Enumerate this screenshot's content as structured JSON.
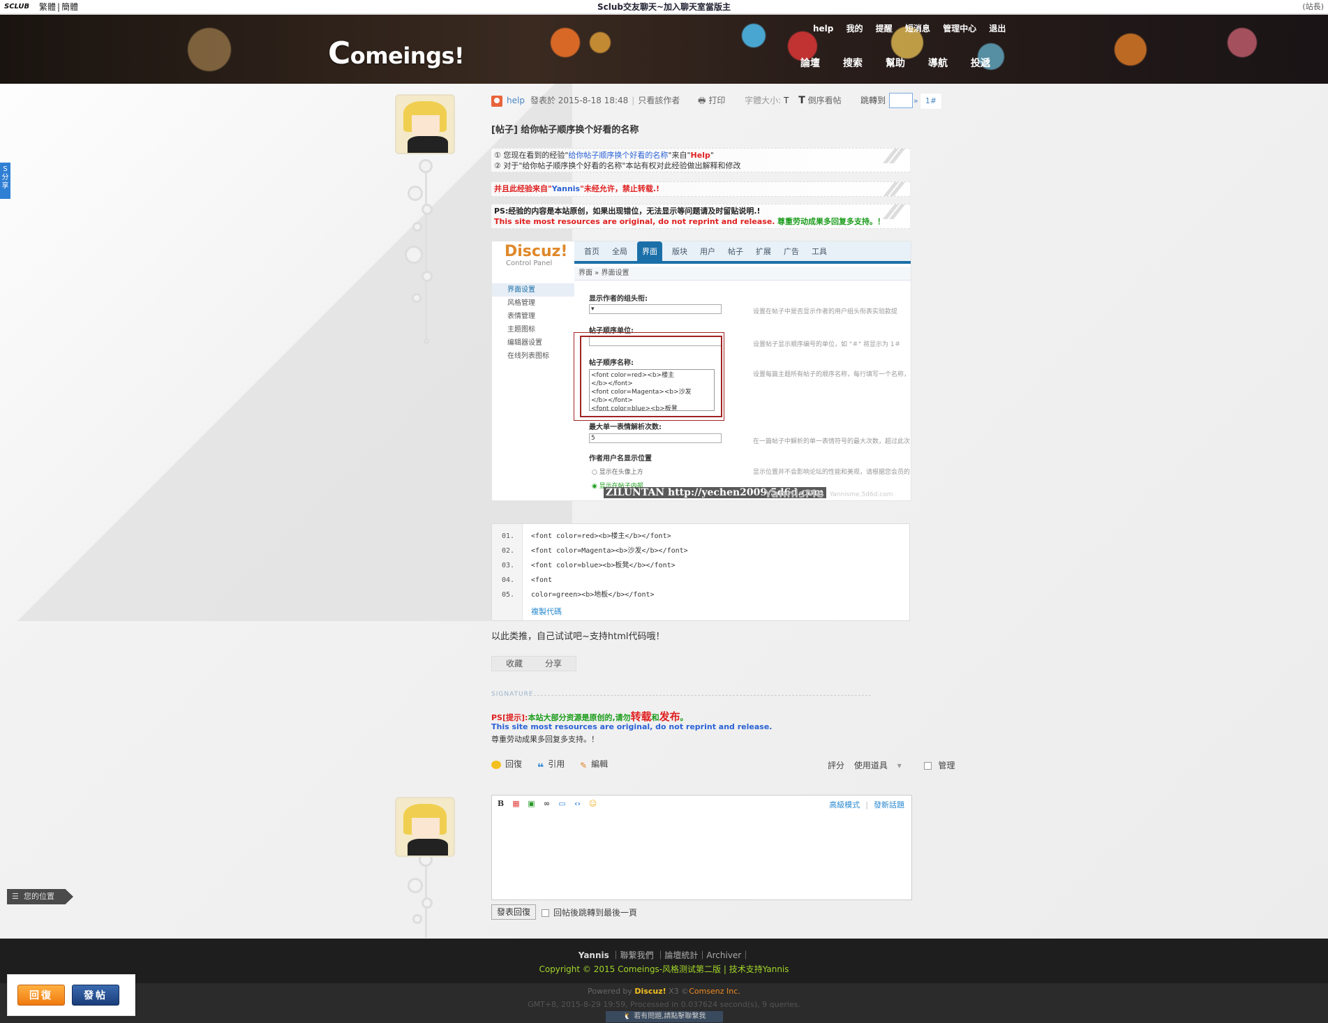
{
  "topbar": {
    "brand": "SCLUB",
    "lang_trad": "繁體",
    "lang_simp": "簡體",
    "center": "Sclub交友聊天~加入聊天室當版主",
    "right": "(站長)"
  },
  "header": {
    "logo_big": "C",
    "logo_rest": "omeings!",
    "user_links": [
      "help",
      "我的",
      "提醒",
      "短消息",
      "管理中心",
      "退出"
    ],
    "nav": [
      "論壇",
      "搜索",
      "幫助",
      "導航",
      "投遞"
    ]
  },
  "share_tab": "分享",
  "post": {
    "author": "help",
    "posted": "發表於 2015-8-18 18:48",
    "only_author": "只看該作者",
    "print": "打印",
    "font_size": "字體大小:",
    "font_t_small": "T",
    "font_t_big": "T",
    "reverse": "倒序看帖",
    "jump": "跳轉到",
    "jump_go": "»",
    "floor": "1#",
    "title": "[帖子] 给你帖子顺序换个好看的名称",
    "info1_a": "① 您现在看到的经验\"",
    "info1_link": "给你帖子顺序换个好看的名称",
    "info1_b": "\"来自\"",
    "info1_src": "Help",
    "info1_c": "\"",
    "info2": "② 对于\"给你帖子顺序换个好看的名称\"本站有权对此经验做出解释和修改",
    "notice_a": "并且此经验来自\"",
    "notice_name": "Yannis",
    "notice_b": "\"未经允许，禁止转载.!",
    "ps_cn": "PS:经验的内容是本站原创，如果出现错位，无法显示等问题请及时留贴说明.!",
    "ps_en": "This site most resources are original, do not reprint and release.",
    "ps_respect": "尊重劳动成果多回复多支持。！",
    "body": "以此类推，自己试试吧~支持html代码哦！",
    "fav": "收藏",
    "share": "分享"
  },
  "screenshot": {
    "logo": "Discuz!",
    "logo_sub": "Control Panel",
    "tabs": [
      "首页",
      "全局",
      "界面",
      "版块",
      "用户",
      "帖子",
      "扩展",
      "广告",
      "工具"
    ],
    "breadcrumb": "界面 » 界面设置",
    "side": [
      "界面设置",
      "风格管理",
      "表情管理",
      "主题图标",
      "编辑器设置",
      "在线列表图标"
    ],
    "lbl1": "显示作者的组头衔:",
    "hint1": "设置在帖子中是否显示作者的用户组头衔表实验款提",
    "lbl2": "帖子顺序单位:",
    "hint2": "设置帖子显示顺序编号的单位，如 \"＃\" 将显示为 1＃",
    "lbl3": "帖子顺序名称:",
    "hint3": "设置每篇主题所有帖子的顺序名称，每行填写一个名称，",
    "ta_lines": [
      "<font color=red><b>楼主",
      "</b></font>",
      "<font color=Magenta><b>沙发",
      "</b></font>",
      "<font color=blue><b>板凳"
    ],
    "lbl4": "最大单一表情解析次数:",
    "val4": "5",
    "hint4": "在一篇帖子中解析的单一表情符号的最大次数，超过此次",
    "lbl5": "作者用户名显示位置",
    "radio1": "显示在头像上方",
    "radio2": "显示在帖子内部",
    "hint5": "显示位置并不会影响论坛的性能和美观，请根据您会员的",
    "wm": "ZILUNTAN http://yechen2009.5d6d.com",
    "wm2": "YannisMe",
    "wm3": "Yannisme.5d6d.com"
  },
  "code": {
    "lines": [
      {
        "n": "01.",
        "t": "<font color=red><b>楼主</b></font>"
      },
      {
        "n": "02.",
        "t": "<font color=Magenta><b>沙发</b></font>"
      },
      {
        "n": "03.",
        "t": "<font color=blue><b>板凳</b></font>"
      },
      {
        "n": "04.",
        "t": "<font"
      },
      {
        "n": "05.",
        "t": "color=green><b>地板</b></font>"
      }
    ],
    "copy": "複製代碼"
  },
  "signature": {
    "label": "SIGNATURE",
    "ps": "PS[提示]:",
    "l1_a": "本站大部分资源是原创的,请勿",
    "l1_b": "转载",
    "l1_c": "和",
    "l1_d": "发布",
    "l1_e": "。",
    "l2": "This site most resources are original, do not reprint and release.",
    "l3": "尊重劳动成果多回复多支持。！"
  },
  "actions": {
    "reply": "回復",
    "quote": "引用",
    "edit": "編輯",
    "rate": "評分",
    "tools": "使用道具",
    "manage": "管理"
  },
  "editor": {
    "advanced": "高級模式",
    "new_topic": "發新話題",
    "submit": "發表回復",
    "after": "回帖後跳轉到最後一頁"
  },
  "location": "您的位置",
  "footer": {
    "name": "Yannis",
    "links": "聯繫我們 ｜論壇統計｜Archiver｜",
    "copyright": "Copyright © 2015 Comeings-风格测试第二版 | 技术支持Yannis",
    "powered_a": "Powered by ",
    "powered_b": "Discuz!",
    "powered_c": " X3 ©",
    "powered_d": "Comsenz Inc.",
    "stats": "GMT+8, 2015-8-29 19:59, Processed in 0.037624 second(s), 9 queries.",
    "qq": "若有問題,請點擊聯繫我"
  },
  "float": {
    "reply": "回復",
    "post": "發帖"
  }
}
